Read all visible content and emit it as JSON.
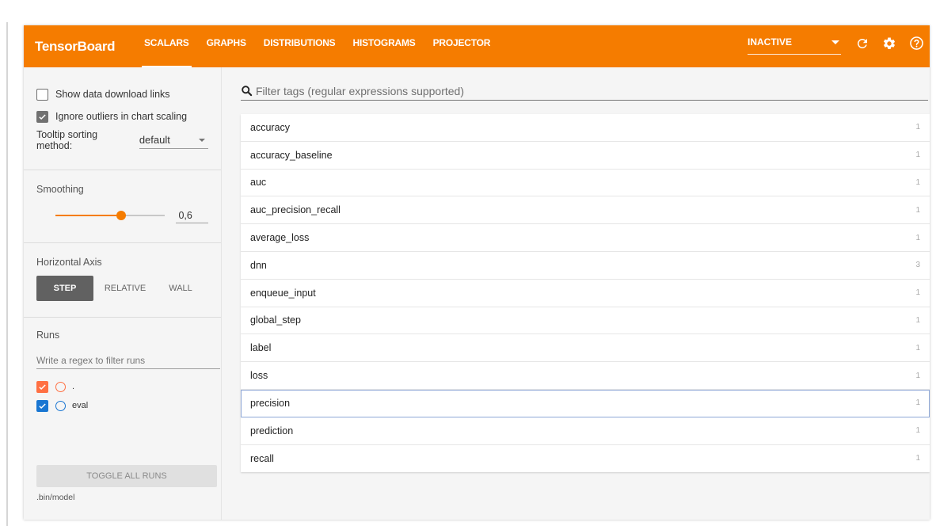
{
  "app": {
    "brand": "TensorBoard",
    "tabs": [
      {
        "label": "SCALARS",
        "active": true
      },
      {
        "label": "GRAPHS",
        "active": false
      },
      {
        "label": "DISTRIBUTIONS",
        "active": false
      },
      {
        "label": "HISTOGRAMS",
        "active": false
      },
      {
        "label": "PROJECTOR",
        "active": false
      }
    ],
    "run_select_value": "INACTIVE",
    "icons": [
      "refresh-icon",
      "settings-icon",
      "help-icon"
    ],
    "accent_color": "#f57c00"
  },
  "sidebar": {
    "show_download_label": "Show data download links",
    "show_download_checked": false,
    "ignore_outliers_label": "Ignore outliers in chart scaling",
    "ignore_outliers_checked": true,
    "tooltip_label": "Tooltip sorting method:",
    "tooltip_value": "default",
    "smoothing_label": "Smoothing",
    "smoothing_value": "0,6",
    "smoothing_fraction": 0.6,
    "horizontal_axis_label": "Horizontal Axis",
    "axis_options": [
      {
        "label": "STEP",
        "active": true
      },
      {
        "label": "RELATIVE",
        "active": false
      },
      {
        "label": "WALL",
        "active": false
      }
    ],
    "runs_label": "Runs",
    "runs_filter_placeholder": "Write a regex to filter runs",
    "runs": [
      {
        "name": ".",
        "checked": true,
        "color": "#ff7043"
      },
      {
        "name": "eval",
        "checked": true,
        "color": "#1976d2"
      }
    ],
    "toggle_all_label": "TOGGLE ALL RUNS",
    "logdir": ".bin/model"
  },
  "main": {
    "filter_placeholder": "Filter tags (regular expressions supported)",
    "tags": [
      {
        "name": "accuracy",
        "count": "1"
      },
      {
        "name": "accuracy_baseline",
        "count": "1"
      },
      {
        "name": "auc",
        "count": "1"
      },
      {
        "name": "auc_precision_recall",
        "count": "1"
      },
      {
        "name": "average_loss",
        "count": "1"
      },
      {
        "name": "dnn",
        "count": "3"
      },
      {
        "name": "enqueue_input",
        "count": "1"
      },
      {
        "name": "global_step",
        "count": "1"
      },
      {
        "name": "label",
        "count": "1"
      },
      {
        "name": "loss",
        "count": "1"
      },
      {
        "name": "precision",
        "count": "1"
      },
      {
        "name": "prediction",
        "count": "1"
      },
      {
        "name": "recall",
        "count": "1"
      }
    ]
  }
}
